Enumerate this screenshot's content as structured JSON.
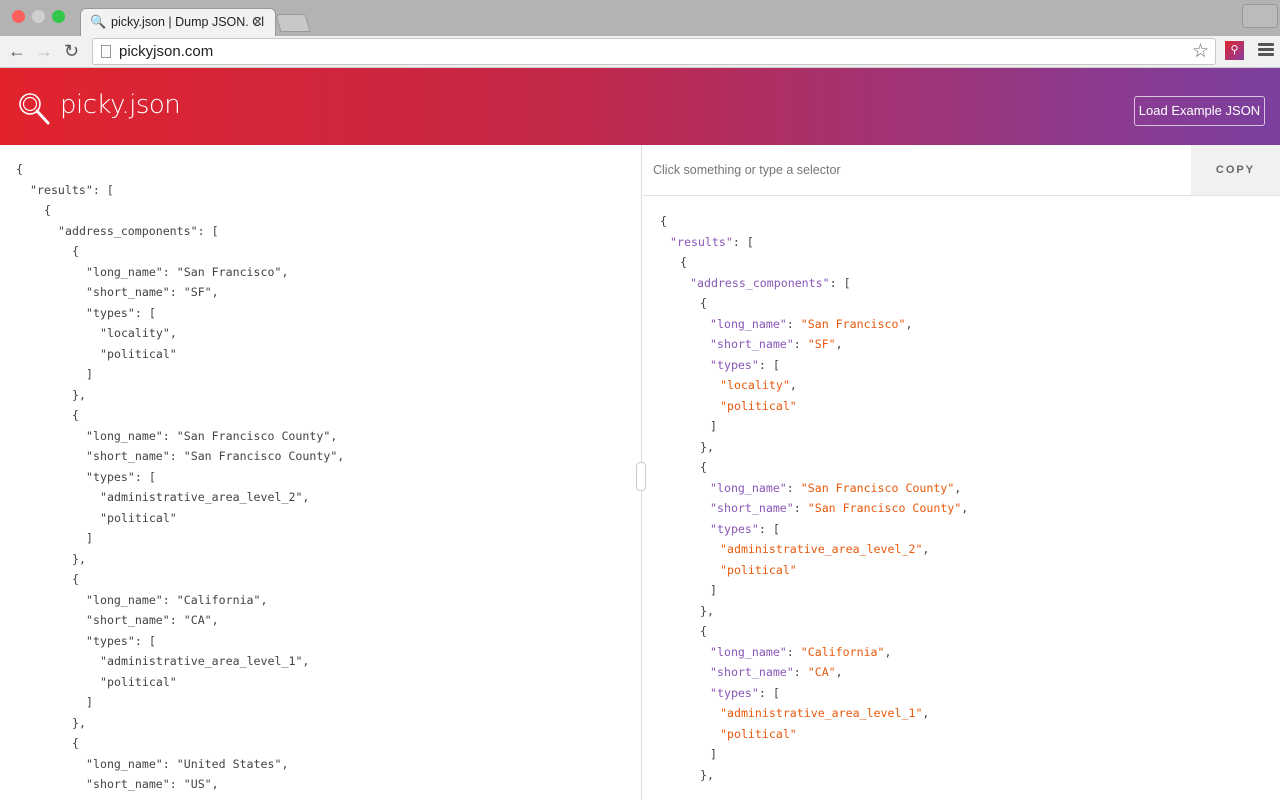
{
  "browser": {
    "tab_title": "picky.json | Dump JSON. Cl",
    "url": "pickyjson.com"
  },
  "header": {
    "logo": "picky.json",
    "load_button": "Load Example JSON",
    "gradient_start": "#e2232c",
    "gradient_end": "#7b3f9e"
  },
  "selector": {
    "placeholder": "Click something or type a selector",
    "copy_label": "COPY"
  },
  "colors": {
    "key": "#8a57b8",
    "value": "#e8590c"
  },
  "json_lines": [
    {
      "d": 0,
      "s": "{"
    },
    {
      "d": 1,
      "k": "results",
      "s": "["
    },
    {
      "d": 2,
      "s": "{"
    },
    {
      "d": 3,
      "k": "address_components",
      "s": "["
    },
    {
      "d": 4,
      "s": "{"
    },
    {
      "d": 5,
      "k": "long_name",
      "v": "San Francisco",
      "s": ","
    },
    {
      "d": 5,
      "k": "short_name",
      "v": "SF",
      "s": ","
    },
    {
      "d": 5,
      "k": "types",
      "s": "["
    },
    {
      "d": 6,
      "v": "locality",
      "s": ","
    },
    {
      "d": 6,
      "v": "political"
    },
    {
      "d": 5,
      "s": "]"
    },
    {
      "d": 4,
      "s": "},"
    },
    {
      "d": 4,
      "s": "{"
    },
    {
      "d": 5,
      "k": "long_name",
      "v": "San Francisco County",
      "s": ","
    },
    {
      "d": 5,
      "k": "short_name",
      "v": "San Francisco County",
      "s": ","
    },
    {
      "d": 5,
      "k": "types",
      "s": "["
    },
    {
      "d": 6,
      "v": "administrative_area_level_2",
      "s": ","
    },
    {
      "d": 6,
      "v": "political"
    },
    {
      "d": 5,
      "s": "]"
    },
    {
      "d": 4,
      "s": "},"
    },
    {
      "d": 4,
      "s": "{"
    },
    {
      "d": 5,
      "k": "long_name",
      "v": "California",
      "s": ","
    },
    {
      "d": 5,
      "k": "short_name",
      "v": "CA",
      "s": ","
    },
    {
      "d": 5,
      "k": "types",
      "s": "["
    },
    {
      "d": 6,
      "v": "administrative_area_level_1",
      "s": ","
    },
    {
      "d": 6,
      "v": "political"
    },
    {
      "d": 5,
      "s": "]"
    },
    {
      "d": 4,
      "s": "},"
    },
    {
      "d": 4,
      "s": "{"
    },
    {
      "d": 5,
      "k": "long_name",
      "v": "United States",
      "s": ","
    },
    {
      "d": 5,
      "k": "short_name",
      "v": "US",
      "s": ","
    }
  ]
}
